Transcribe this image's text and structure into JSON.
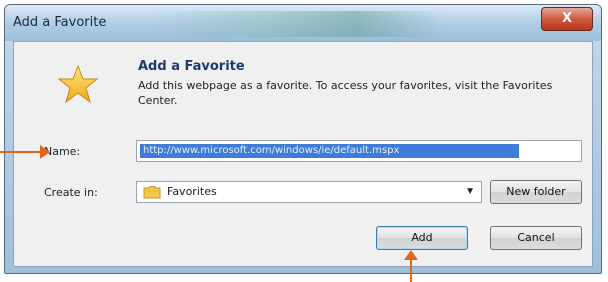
{
  "window": {
    "title": "Add a Favorite",
    "close_label": "X"
  },
  "dialog": {
    "heading": "Add a Favorite",
    "description": "Add this webpage as a favorite. To access your favorites, visit the Favorites Center."
  },
  "form": {
    "name_label": "Name:",
    "name_value": "http://www.microsoft.com/windows/ie/default.mspx",
    "create_in_label": "Create in:",
    "create_in_value": "Favorites"
  },
  "buttons": {
    "new_folder": "New folder",
    "add": "Add",
    "cancel": "Cancel"
  },
  "icons": {
    "star": "star-icon",
    "folder": "folder-icon",
    "dropdown": "chevron-down-icon"
  },
  "colors": {
    "annotation_arrow": "#e0661c",
    "selection": "#3d7dd8"
  }
}
